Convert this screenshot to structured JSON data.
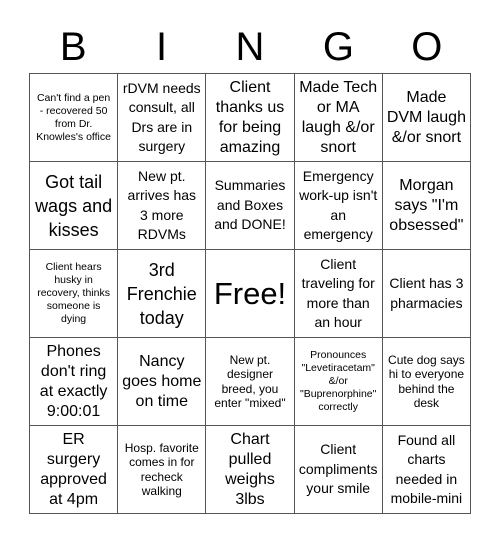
{
  "header": {
    "letters": [
      "B",
      "I",
      "N",
      "G",
      "O"
    ]
  },
  "cells": [
    {
      "text": "Can't find a pen - recovered 50 from Dr. Knowles's office",
      "size": "xs"
    },
    {
      "text": "rDVM needs consult, all Drs are in surgery",
      "size": "md"
    },
    {
      "text": "Client thanks us for being amazing",
      "size": "lg"
    },
    {
      "text": "Made Tech or MA laugh &/or snort",
      "size": "lg"
    },
    {
      "text": "Made DVM laugh &/or snort",
      "size": "lg"
    },
    {
      "text": "Got tail wags and kisses",
      "size": "xl"
    },
    {
      "text": "New pt. arrives has 3 more RDVMs",
      "size": "md"
    },
    {
      "text": "Summaries and Boxes and DONE!",
      "size": "md"
    },
    {
      "text": "Emergency work-up isn't an emergency",
      "size": "md"
    },
    {
      "text": "Morgan says \"I'm obsessed\"",
      "size": "lg"
    },
    {
      "text": "Client hears husky in recovery, thinks someone is dying",
      "size": "xs"
    },
    {
      "text": "3rd Frenchie today",
      "size": "xl"
    },
    {
      "text": "Free!",
      "size": "free"
    },
    {
      "text": "Client traveling for more than an hour",
      "size": "md"
    },
    {
      "text": "Client has 3 pharmacies",
      "size": "md"
    },
    {
      "text": "Phones don't ring at exactly 9:00:01",
      "size": "lg"
    },
    {
      "text": "Nancy goes home on time",
      "size": "lg"
    },
    {
      "text": "New pt. designer breed, you enter \"mixed\"",
      "size": "sm"
    },
    {
      "text": "Pronounces \"Levetiracetam\" &/or \"Buprenorphine\" correctly",
      "size": "xs"
    },
    {
      "text": "Cute dog says hi to everyone behind the desk",
      "size": "sm"
    },
    {
      "text": "ER surgery approved at 4pm",
      "size": "lg"
    },
    {
      "text": "Hosp. favorite comes in for recheck walking",
      "size": "sm"
    },
    {
      "text": "Chart pulled weighs 3lbs",
      "size": "lg"
    },
    {
      "text": "Client compliments your smile",
      "size": "md"
    },
    {
      "text": "Found all charts needed in mobile-mini",
      "size": "md"
    }
  ]
}
